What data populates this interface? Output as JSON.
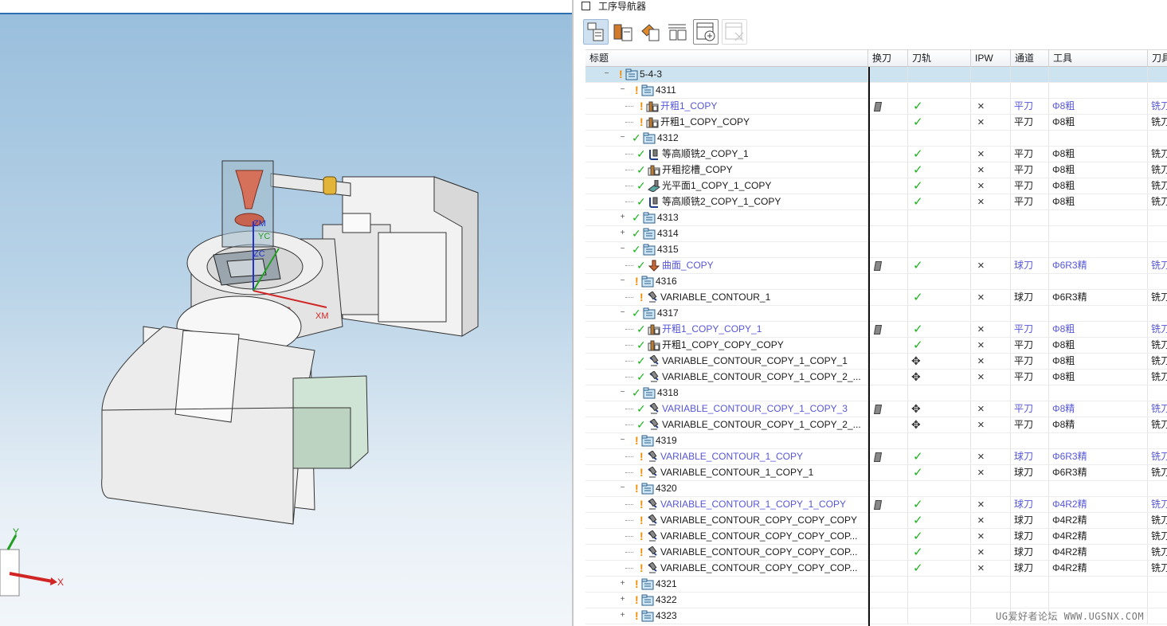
{
  "navigator": {
    "title": "工序导航器",
    "toolbar": [
      "program-order-view-icon",
      "machine-tool-view-icon",
      "geometry-view-icon",
      "method-view-icon",
      "add-column-icon",
      "remove-column-icon"
    ]
  },
  "columns": [
    "标题",
    "换刀",
    "刀轨",
    "IPW",
    "通道",
    "工具",
    "刀具"
  ],
  "rows": [
    {
      "indent": 0,
      "expander": "−",
      "status": "warn",
      "type": "program",
      "name": "5-4-3",
      "selected": true
    },
    {
      "indent": 1,
      "expander": "−",
      "status": "warn",
      "type": "program",
      "name": "4311"
    },
    {
      "indent": 2,
      "status": "warn",
      "type": "cavity",
      "name": "开粗1_COPY",
      "blue": true,
      "change": true,
      "path": "check",
      "ipw": "×",
      "channel": "平刀",
      "tool": "Φ8粗",
      "tooltype": "铣刀"
    },
    {
      "indent": 2,
      "status": "warn",
      "type": "cavity",
      "name": "开粗1_COPY_COPY",
      "path": "check",
      "ipw": "×",
      "channel": "平刀",
      "tool": "Φ8粗",
      "tooltype": "铣刀"
    },
    {
      "indent": 1,
      "expander": "−",
      "status": "ok",
      "type": "program",
      "name": "4312"
    },
    {
      "indent": 2,
      "status": "ok",
      "type": "zlevel",
      "name": "等高顺铣2_COPY_1",
      "path": "check",
      "ipw": "×",
      "channel": "平刀",
      "tool": "Φ8粗",
      "tooltype": "铣刀"
    },
    {
      "indent": 2,
      "status": "ok",
      "type": "cavity",
      "name": "开粗挖槽_COPY",
      "path": "check",
      "ipw": "×",
      "channel": "平刀",
      "tool": "Φ8粗",
      "tooltype": "铣刀"
    },
    {
      "indent": 2,
      "status": "ok",
      "type": "face",
      "name": "光平面1_COPY_1_COPY",
      "path": "check",
      "ipw": "×",
      "channel": "平刀",
      "tool": "Φ8粗",
      "tooltype": "铣刀"
    },
    {
      "indent": 2,
      "status": "ok",
      "type": "zlevel",
      "name": "等高顺铣2_COPY_1_COPY",
      "path": "check",
      "ipw": "×",
      "channel": "平刀",
      "tool": "Φ8粗",
      "tooltype": "铣刀"
    },
    {
      "indent": 1,
      "expander": "+",
      "status": "ok",
      "type": "program",
      "name": "4313"
    },
    {
      "indent": 1,
      "expander": "+",
      "status": "ok",
      "type": "program",
      "name": "4314"
    },
    {
      "indent": 1,
      "expander": "−",
      "status": "ok",
      "type": "program",
      "name": "4315"
    },
    {
      "indent": 2,
      "status": "ok",
      "type": "surface",
      "name": "曲面_COPY",
      "blue": true,
      "change": true,
      "path": "check",
      "ipw": "×",
      "channel": "球刀",
      "tool": "Φ6R3精",
      "tooltype": "铣刀"
    },
    {
      "indent": 1,
      "expander": "−",
      "status": "warn",
      "type": "program",
      "name": "4316"
    },
    {
      "indent": 2,
      "status": "warn",
      "type": "contour",
      "name": "VARIABLE_CONTOUR_1",
      "path": "check",
      "ipw": "×",
      "channel": "球刀",
      "tool": "Φ6R3精",
      "tooltype": "铣刀"
    },
    {
      "indent": 1,
      "expander": "−",
      "status": "ok",
      "type": "program",
      "name": "4317"
    },
    {
      "indent": 2,
      "status": "ok",
      "type": "cavity",
      "name": "开粗1_COPY_COPY_1",
      "blue": true,
      "change": true,
      "path": "check",
      "ipw": "×",
      "channel": "平刀",
      "tool": "Φ8粗",
      "tooltype": "铣刀"
    },
    {
      "indent": 2,
      "status": "ok",
      "type": "cavity",
      "name": "开粗1_COPY_COPY_COPY",
      "path": "check",
      "ipw": "×",
      "channel": "平刀",
      "tool": "Φ8粗",
      "tooltype": "铣刀"
    },
    {
      "indent": 2,
      "status": "ok",
      "type": "contour",
      "name": "VARIABLE_CONTOUR_COPY_1_COPY_1",
      "path": "move",
      "ipw": "×",
      "channel": "平刀",
      "tool": "Φ8粗",
      "tooltype": "铣刀"
    },
    {
      "indent": 2,
      "status": "ok",
      "type": "contour",
      "name": "VARIABLE_CONTOUR_COPY_1_COPY_2_...",
      "path": "move",
      "ipw": "×",
      "channel": "平刀",
      "tool": "Φ8粗",
      "tooltype": "铣刀"
    },
    {
      "indent": 1,
      "expander": "−",
      "status": "ok",
      "type": "program",
      "name": "4318"
    },
    {
      "indent": 2,
      "status": "ok",
      "type": "contour",
      "name": "VARIABLE_CONTOUR_COPY_1_COPY_3",
      "blue": true,
      "change": true,
      "path": "move",
      "ipw": "×",
      "channel": "平刀",
      "tool": "Φ8精",
      "tooltype": "铣刀"
    },
    {
      "indent": 2,
      "status": "ok",
      "type": "contour",
      "name": "VARIABLE_CONTOUR_COPY_1_COPY_2_...",
      "path": "move",
      "ipw": "×",
      "channel": "平刀",
      "tool": "Φ8精",
      "tooltype": "铣刀"
    },
    {
      "indent": 1,
      "expander": "−",
      "status": "warn",
      "type": "program",
      "name": "4319"
    },
    {
      "indent": 2,
      "status": "warn",
      "type": "contour",
      "name": "VARIABLE_CONTOUR_1_COPY",
      "blue": true,
      "change": true,
      "path": "check",
      "ipw": "×",
      "channel": "球刀",
      "tool": "Φ6R3精",
      "tooltype": "铣刀"
    },
    {
      "indent": 2,
      "status": "warn",
      "type": "contour",
      "name": "VARIABLE_CONTOUR_1_COPY_1",
      "path": "check",
      "ipw": "×",
      "channel": "球刀",
      "tool": "Φ6R3精",
      "tooltype": "铣刀"
    },
    {
      "indent": 1,
      "expander": "−",
      "status": "warn",
      "type": "program",
      "name": "4320"
    },
    {
      "indent": 2,
      "status": "warn",
      "type": "contour",
      "name": "VARIABLE_CONTOUR_1_COPY_1_COPY",
      "blue": true,
      "change": true,
      "path": "check",
      "ipw": "×",
      "channel": "球刀",
      "tool": "Φ4R2精",
      "tooltype": "铣刀"
    },
    {
      "indent": 2,
      "status": "warn",
      "type": "contour",
      "name": "VARIABLE_CONTOUR_COPY_COPY_COPY",
      "path": "check",
      "ipw": "×",
      "channel": "球刀",
      "tool": "Φ4R2精",
      "tooltype": "铣刀"
    },
    {
      "indent": 2,
      "status": "warn",
      "type": "contour",
      "name": "VARIABLE_CONTOUR_COPY_COPY_COP...",
      "path": "check",
      "ipw": "×",
      "channel": "球刀",
      "tool": "Φ4R2精",
      "tooltype": "铣刀"
    },
    {
      "indent": 2,
      "status": "warn",
      "type": "contour",
      "name": "VARIABLE_CONTOUR_COPY_COPY_COP...",
      "path": "check",
      "ipw": "×",
      "channel": "球刀",
      "tool": "Φ4R2精",
      "tooltype": "铣刀"
    },
    {
      "indent": 2,
      "status": "warn",
      "type": "contour",
      "name": "VARIABLE_CONTOUR_COPY_COPY_COP...",
      "path": "check",
      "ipw": "×",
      "channel": "球刀",
      "tool": "Φ4R2精",
      "tooltype": "铣刀"
    },
    {
      "indent": 1,
      "expander": "+",
      "status": "warn",
      "type": "program",
      "name": "4321"
    },
    {
      "indent": 1,
      "expander": "+",
      "status": "warn",
      "type": "program",
      "name": "4322"
    },
    {
      "indent": 1,
      "expander": "+",
      "status": "warn",
      "type": "program",
      "name": "4323"
    }
  ],
  "viewport": {
    "axis_labels": {
      "zm": "ZM",
      "xc": "XC",
      "xm": "XM",
      "yc": "YC",
      "zc": "ZC"
    },
    "triad": {
      "x": "X",
      "y": "Y"
    }
  },
  "watermark": "UG爱好者论坛 WWW.UGSNX.COM",
  "colors": {
    "accent": "#2e6fb0",
    "ok": "#19b31a",
    "warn": "#f08c00",
    "highlight": "#5656d8",
    "selected": "#cde3ef"
  }
}
